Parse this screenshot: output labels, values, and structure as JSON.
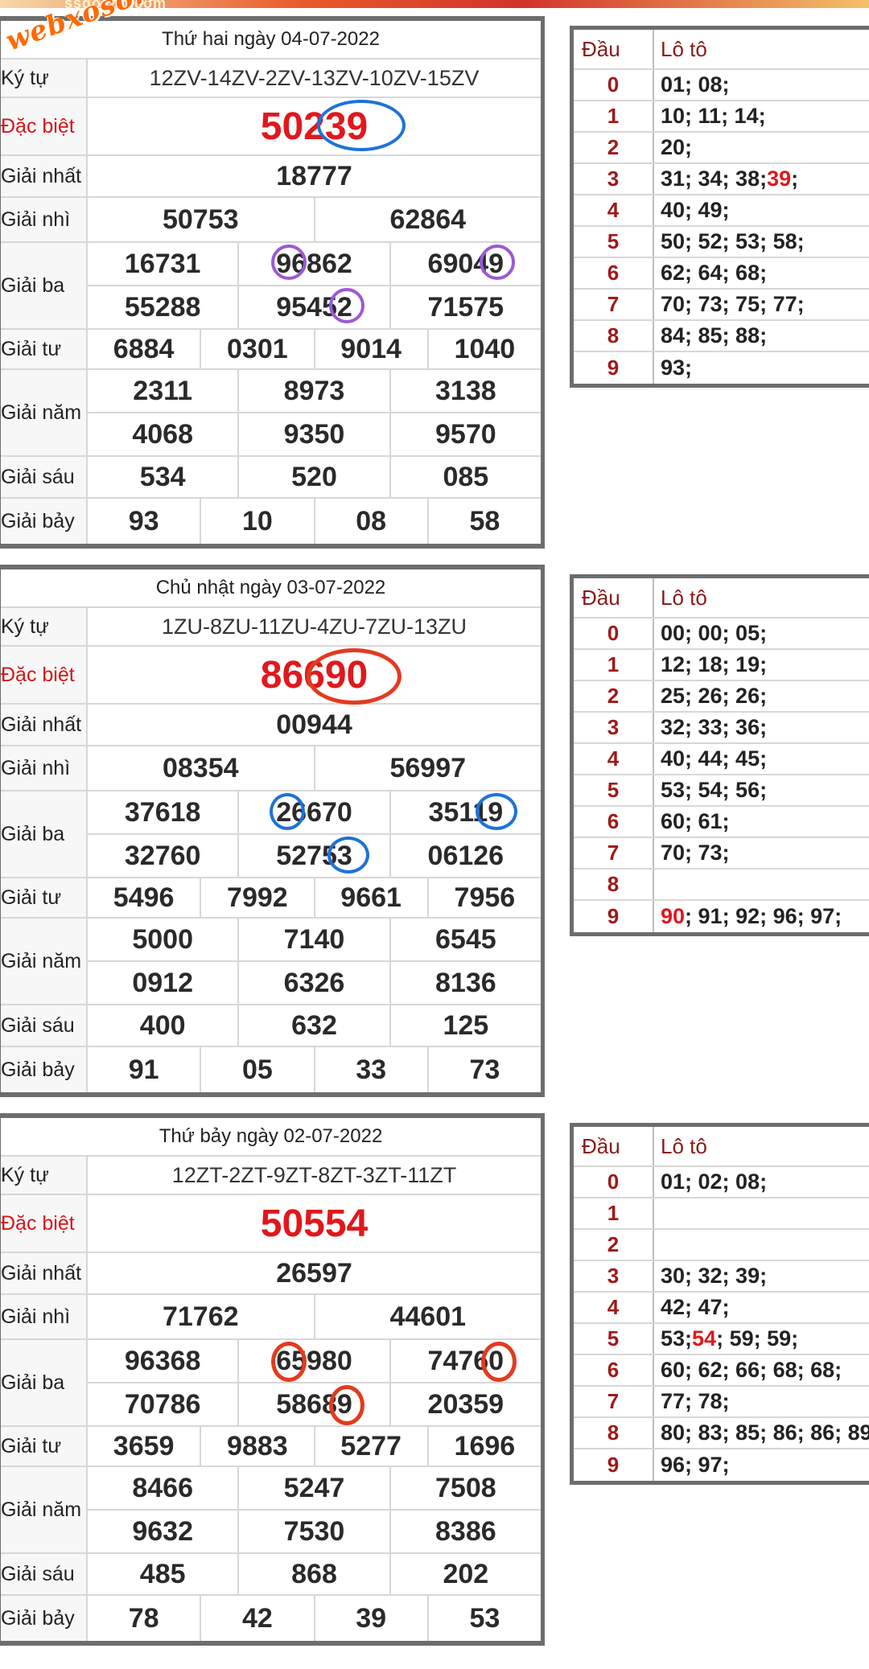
{
  "topbar": {
    "text": "ssdoson.com"
  },
  "watermark": "webxoso.net",
  "draws": [
    {
      "date": "Thứ hai ngày 04-07-2022",
      "kytu": "12ZV-14ZV-2ZV-13ZV-10ZV-15ZV",
      "labels": {
        "kytu": "Ký tự",
        "db": "Đặc biệt",
        "g1": "Giải nhất",
        "g2": "Giải nhì",
        "g3": "Giải ba",
        "g4": "Giải tư",
        "g5": "Giải năm",
        "g6": "Giải sáu",
        "g7": "Giải bảy"
      },
      "db": "50239",
      "g1": "18777",
      "g2": [
        "50753",
        "62864"
      ],
      "g3": [
        [
          "16731",
          "96862",
          "69049"
        ],
        [
          "55288",
          "95452",
          "71575"
        ]
      ],
      "g4": [
        "6884",
        "0301",
        "9014",
        "1040"
      ],
      "g5": [
        [
          "2311",
          "8973",
          "3138"
        ],
        [
          "4068",
          "9350",
          "9570"
        ]
      ],
      "g6": [
        "534",
        "520",
        "085"
      ],
      "g7": [
        "93",
        "10",
        "08",
        "58"
      ],
      "loto_header": {
        "dau": "Đầu",
        "loto": "Lô tô"
      },
      "loto": [
        {
          "dau": "0",
          "v": "01; 08;",
          "hl": ""
        },
        {
          "dau": "1",
          "v": "10; 11; 14;",
          "hl": ""
        },
        {
          "dau": "2",
          "v": "20;",
          "hl": ""
        },
        {
          "dau": "3",
          "v": "31; 34; 38; ",
          "hl": "39",
          "post": ";"
        },
        {
          "dau": "4",
          "v": "40; 49;",
          "hl": ""
        },
        {
          "dau": "5",
          "v": "50; 52; 53; 58;",
          "hl": ""
        },
        {
          "dau": "6",
          "v": "62; 64; 68;",
          "hl": ""
        },
        {
          "dau": "7",
          "v": "70; 73; 75; 77;",
          "hl": ""
        },
        {
          "dau": "8",
          "v": "84; 85; 88;",
          "hl": ""
        },
        {
          "dau": "9",
          "v": "93;",
          "hl": ""
        }
      ]
    },
    {
      "date": "Chủ nhật ngày 03-07-2022",
      "kytu": "1ZU-8ZU-11ZU-4ZU-7ZU-13ZU",
      "labels": {
        "kytu": "Ký tự",
        "db": "Đặc biệt",
        "g1": "Giải nhất",
        "g2": "Giải nhì",
        "g3": "Giải ba",
        "g4": "Giải tư",
        "g5": "Giải năm",
        "g6": "Giải sáu",
        "g7": "Giải bảy"
      },
      "db": "86690",
      "g1": "00944",
      "g2": [
        "08354",
        "56997"
      ],
      "g3": [
        [
          "37618",
          "26670",
          "35119"
        ],
        [
          "32760",
          "52753",
          "06126"
        ]
      ],
      "g4": [
        "5496",
        "7992",
        "9661",
        "7956"
      ],
      "g5": [
        [
          "5000",
          "7140",
          "6545"
        ],
        [
          "0912",
          "6326",
          "8136"
        ]
      ],
      "g6": [
        "400",
        "632",
        "125"
      ],
      "g7": [
        "91",
        "05",
        "33",
        "73"
      ],
      "loto_header": {
        "dau": "Đầu",
        "loto": "Lô tô"
      },
      "loto": [
        {
          "dau": "0",
          "v": "00; 00; 05;",
          "hl": ""
        },
        {
          "dau": "1",
          "v": "12; 18; 19;",
          "hl": ""
        },
        {
          "dau": "2",
          "v": "25; 26; 26;",
          "hl": ""
        },
        {
          "dau": "3",
          "v": "32; 33; 36;",
          "hl": ""
        },
        {
          "dau": "4",
          "v": "40; 44; 45;",
          "hl": ""
        },
        {
          "dau": "5",
          "v": "53; 54; 56;",
          "hl": ""
        },
        {
          "dau": "6",
          "v": "60; 61;",
          "hl": ""
        },
        {
          "dau": "7",
          "v": "70; 73;",
          "hl": ""
        },
        {
          "dau": "8",
          "v": "",
          "hl": ""
        },
        {
          "dau": "9",
          "v": "",
          "hl": "90",
          "post": "; 91; 92; 96; 97;"
        }
      ]
    },
    {
      "date": "Thứ bảy ngày 02-07-2022",
      "kytu": "12ZT-2ZT-9ZT-8ZT-3ZT-11ZT",
      "labels": {
        "kytu": "Ký tự",
        "db": "Đặc biệt",
        "g1": "Giải nhất",
        "g2": "Giải nhì",
        "g3": "Giải ba",
        "g4": "Giải tư",
        "g5": "Giải năm",
        "g6": "Giải sáu",
        "g7": "Giải bảy"
      },
      "db": "50554",
      "g1": "26597",
      "g2": [
        "71762",
        "44601"
      ],
      "g3": [
        [
          "96368",
          "65980",
          "74760"
        ],
        [
          "70786",
          "58689",
          "20359"
        ]
      ],
      "g4": [
        "3659",
        "9883",
        "5277",
        "1696"
      ],
      "g5": [
        [
          "8466",
          "5247",
          "7508"
        ],
        [
          "9632",
          "7530",
          "8386"
        ]
      ],
      "g6": [
        "485",
        "868",
        "202"
      ],
      "g7": [
        "78",
        "42",
        "39",
        "53"
      ],
      "loto_header": {
        "dau": "Đầu",
        "loto": "Lô tô"
      },
      "loto": [
        {
          "dau": "0",
          "v": "01; 02; 08;",
          "hl": ""
        },
        {
          "dau": "1",
          "v": "",
          "hl": ""
        },
        {
          "dau": "2",
          "v": "",
          "hl": ""
        },
        {
          "dau": "3",
          "v": "30; 32; 39;",
          "hl": ""
        },
        {
          "dau": "4",
          "v": "42; 47;",
          "hl": ""
        },
        {
          "dau": "5",
          "v": "53; ",
          "hl": "54",
          "post": "; 59; 59;"
        },
        {
          "dau": "6",
          "v": "60; 62; 66; 68; 68;",
          "hl": ""
        },
        {
          "dau": "7",
          "v": "77; 78;",
          "hl": ""
        },
        {
          "dau": "8",
          "v": "80; 83; 85; 86; 86; 89",
          "hl": ""
        },
        {
          "dau": "9",
          "v": "96; 97;",
          "hl": ""
        }
      ]
    }
  ]
}
